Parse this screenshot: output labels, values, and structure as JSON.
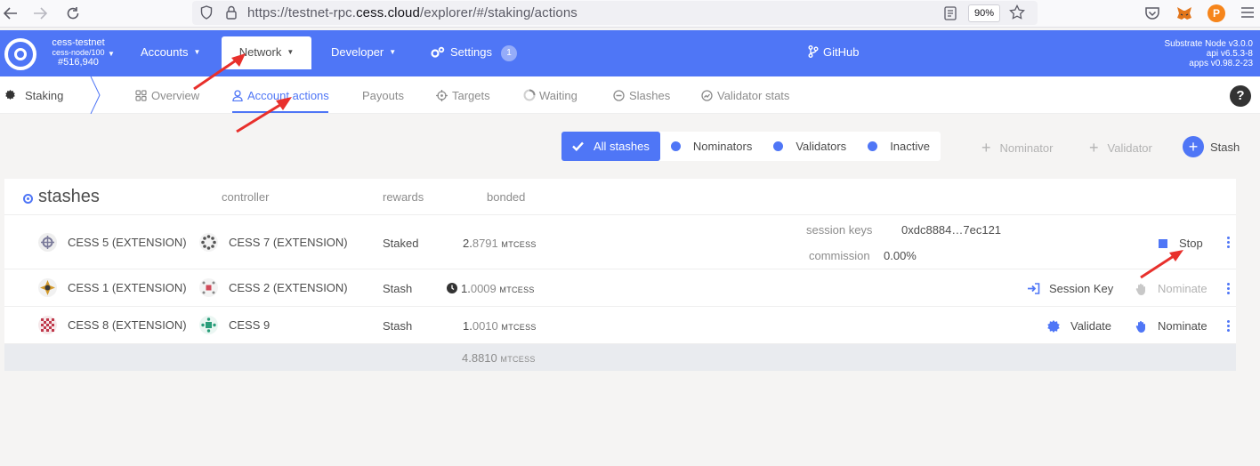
{
  "browser": {
    "url_prefix": "https://testnet-rpc.",
    "url_domain": "cess.cloud",
    "url_suffix": "/explorer/#/staking/actions",
    "zoom": "90%"
  },
  "header": {
    "chain_name": "cess-testnet",
    "node": "cess-node/100",
    "block": "#516,940",
    "menu": {
      "accounts": "Accounts",
      "network": "Network",
      "developer": "Developer",
      "settings": "Settings",
      "settings_badge": "1",
      "github": "GitHub"
    },
    "version": {
      "node": "Substrate Node v3.0.0",
      "api": "api v6.5.3-8",
      "apps": "apps v0.98.2-23"
    }
  },
  "subtabs": {
    "section": "Staking",
    "tabs": [
      "Overview",
      "Account actions",
      "Payouts",
      "Targets",
      "Waiting",
      "Slashes",
      "Validator stats"
    ],
    "active": "Account actions"
  },
  "filters": {
    "all_stashes": "All stashes",
    "nominators": "Nominators",
    "validators": "Validators",
    "inactive": "Inactive"
  },
  "actions": {
    "nominator": "Nominator",
    "validator": "Validator",
    "stash": "Stash"
  },
  "table": {
    "headers": {
      "stashes": "stashes",
      "controller": "controller",
      "rewards": "rewards",
      "bonded": "bonded"
    },
    "rows": [
      {
        "stash": "CESS 5 (EXTENSION)",
        "controller": "CESS 7 (EXTENSION)",
        "rewards": "Staked",
        "bonded_int": "2.",
        "bonded_dec": "8791",
        "unit": "MTCESS",
        "session_keys_label": "session keys",
        "session_keys": "0xdc8884…7ec121",
        "commission_label": "commission",
        "commission": "0.00%",
        "action": "Stop"
      },
      {
        "stash": "CESS 1 (EXTENSION)",
        "controller": "CESS 2 (EXTENSION)",
        "rewards": "Stash",
        "bonded_int": "1.",
        "bonded_dec": "0009",
        "unit": "MTCESS",
        "action1": "Session Key",
        "action2": "Nominate"
      },
      {
        "stash": "CESS 8 (EXTENSION)",
        "controller": "CESS 9",
        "rewards": "Stash",
        "bonded_int": "1.",
        "bonded_dec": "0010",
        "unit": "MTCESS",
        "action1": "Validate",
        "action2": "Nominate"
      }
    ],
    "total_int": "4.",
    "total_dec": "8810",
    "total_unit": "MTCESS"
  },
  "colors": {
    "accent": "#4f76f6",
    "annotation_arrow": "#e8302c"
  }
}
